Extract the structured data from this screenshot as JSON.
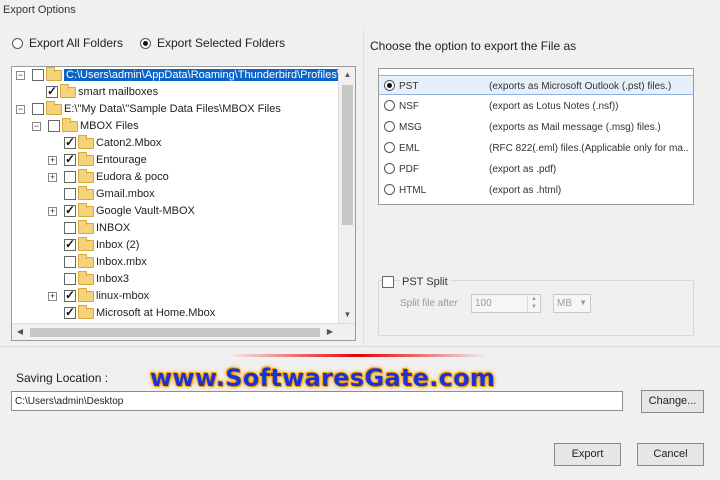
{
  "window": {
    "title": "Export Options"
  },
  "export_mode": {
    "options": [
      {
        "label": "Export All Folders",
        "selected": false
      },
      {
        "label": "Export Selected Folders",
        "selected": true
      }
    ]
  },
  "tree": {
    "rows": [
      {
        "label": "C:\\Users\\admin\\AppData\\Roaming\\Thunderbird\\Profiles\\",
        "checked": false,
        "expand": "−",
        "selected": true
      },
      {
        "label": "smart mailboxes",
        "checked": true,
        "expand": ""
      },
      {
        "label": "E:\\\"My Data\\\"Sample Data Files\\MBOX Files",
        "checked": false,
        "expand": "−"
      },
      {
        "label": "MBOX Files",
        "checked": false,
        "expand": "−"
      },
      {
        "label": "Caton2.Mbox",
        "checked": true,
        "expand": ""
      },
      {
        "label": "Entourage",
        "checked": true,
        "expand": "+"
      },
      {
        "label": "Eudora & poco",
        "checked": false,
        "expand": "+"
      },
      {
        "label": "Gmail.mbox",
        "checked": false,
        "expand": ""
      },
      {
        "label": "Google Vault-MBOX",
        "checked": true,
        "expand": "+"
      },
      {
        "label": "INBOX",
        "checked": false,
        "expand": ""
      },
      {
        "label": "Inbox (2)",
        "checked": true,
        "expand": ""
      },
      {
        "label": "Inbox.mbx",
        "checked": false,
        "expand": ""
      },
      {
        "label": "Inbox3",
        "checked": false,
        "expand": ""
      },
      {
        "label": "linux-mbox",
        "checked": true,
        "expand": "+"
      },
      {
        "label": "Microsoft at Home.Mbox",
        "checked": true,
        "expand": ""
      }
    ]
  },
  "format": {
    "heading": "Choose the option to export the File as",
    "options": [
      {
        "name": "PST",
        "desc": "(exports as Microsoft Outlook (.pst) files.)",
        "selected": true
      },
      {
        "name": "NSF",
        "desc": "(export as Lotus Notes (.nsf))",
        "selected": false
      },
      {
        "name": "MSG",
        "desc": "(exports as Mail message (.msg) files.)",
        "selected": false
      },
      {
        "name": "EML",
        "desc": "(RFC 822(.eml) files.(Applicable only for ma...",
        "selected": false
      },
      {
        "name": "PDF",
        "desc": "(export as .pdf)",
        "selected": false
      },
      {
        "name": "HTML",
        "desc": "(export as .html)",
        "selected": false
      }
    ]
  },
  "split": {
    "label": "PST Split",
    "checked": false,
    "after_label": "Split file after",
    "size_value": "100",
    "unit": "MB"
  },
  "watermark": {
    "text": "www.SoftwaresGate.com"
  },
  "saving": {
    "label": "Saving Location :",
    "path": "C:\\Users\\admin\\Desktop",
    "change_label": "Change..."
  },
  "buttons": {
    "export": "Export",
    "cancel": "Cancel"
  }
}
